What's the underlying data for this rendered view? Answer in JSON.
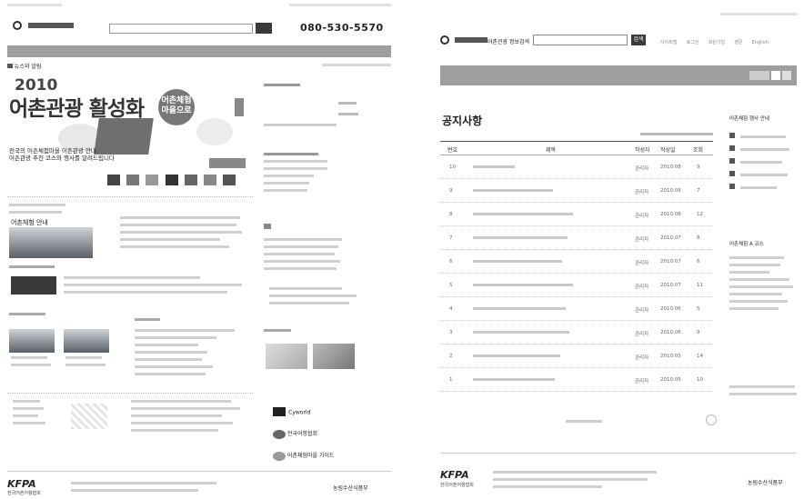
{
  "left": {
    "phone": "080-530-5570",
    "breadcrumb_title": "뉴스와 알림",
    "banner_year": "2010",
    "banner_title": "어촌관광 활성화",
    "banner_badge_line1": "어촌체험",
    "banner_badge_line2": "마을으로",
    "banner_subtitle_line1": "전국의 어촌체험마을 어촌관광 안내",
    "banner_subtitle_line2": "어촌관광 추천 코스와 행사를 알려드립니다",
    "section_title_1": "어촌체험 안내",
    "footer_logo": "KFPA",
    "footer_org": "한국어촌어항협회",
    "footer_right": "농림수산식품부",
    "right_logos": [
      "Cyworld",
      "전국어항협회",
      "어촌체험마을 가이드"
    ]
  },
  "right": {
    "search_label": "어촌관광 정보검색",
    "search_button": "검색",
    "top_links": [
      "사이트맵",
      "로그인",
      "회원가입",
      "영문",
      "English"
    ],
    "page_title": "공지사항",
    "table_headers": [
      "번호",
      "제목",
      "작성자",
      "작성일",
      "조회"
    ],
    "rows": [
      {
        "num": "10",
        "author": "관리자",
        "date": "2010.08",
        "views": "9"
      },
      {
        "num": "9",
        "author": "관리자",
        "date": "2010.08",
        "views": "7"
      },
      {
        "num": "8",
        "author": "관리자",
        "date": "2010.08",
        "views": "12"
      },
      {
        "num": "7",
        "author": "관리자",
        "date": "2010.07",
        "views": "8"
      },
      {
        "num": "6",
        "author": "관리자",
        "date": "2010.07",
        "views": "6"
      },
      {
        "num": "5",
        "author": "관리자",
        "date": "2010.07",
        "views": "11"
      },
      {
        "num": "4",
        "author": "관리자",
        "date": "2010.06",
        "views": "5"
      },
      {
        "num": "3",
        "author": "관리자",
        "date": "2010.06",
        "views": "9"
      },
      {
        "num": "2",
        "author": "관리자",
        "date": "2010.05",
        "views": "14"
      },
      {
        "num": "1",
        "author": "관리자",
        "date": "2010.05",
        "views": "10"
      }
    ],
    "sidebar_title_1": "어촌체험 행사 안내",
    "sidebar_title_2": "어촌체험 A 코스",
    "footer_logo": "KFPA",
    "footer_org": "한국어촌어항협회",
    "footer_right": "농림수산식품부"
  }
}
